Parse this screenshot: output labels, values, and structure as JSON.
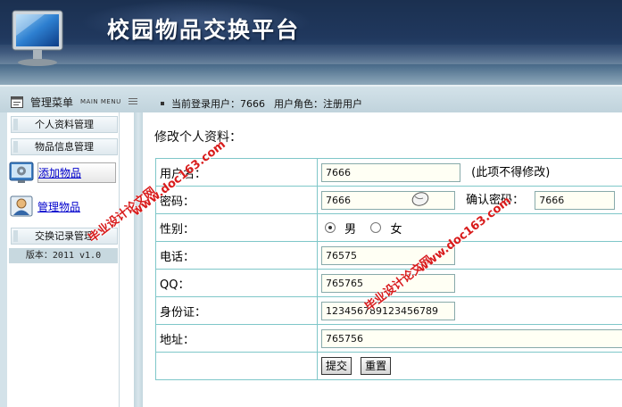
{
  "header": {
    "site_title": "校园物品交换平台"
  },
  "subbar": {
    "menu_title": "管理菜单",
    "menu_subtitle": "MAIN MENU",
    "login_text": "当前登录用户：7666",
    "role_text": "用户角色：注册用户"
  },
  "sidebar": {
    "sections": [
      {
        "label": "个人资料管理"
      },
      {
        "label": "物品信息管理"
      },
      {
        "label": "交换记录管理"
      }
    ],
    "links": [
      {
        "label": "添加物品",
        "icon": "gear-monitor-icon",
        "active": true
      },
      {
        "label": "管理物品",
        "icon": "user-card-icon",
        "active": false
      }
    ],
    "version": "版本：2011 v1.0"
  },
  "form": {
    "title": "修改个人资料：",
    "username_label": "用户名：",
    "username_value": "7666",
    "username_note": "(此项不得修改)",
    "password_label": "密码：",
    "password_value": "7666",
    "confirm_label": "确认密码：",
    "confirm_value": "7666",
    "gender_label": "性别：",
    "gender_male": "男",
    "gender_female": "女",
    "gender_selected": "男",
    "phone_label": "电话：",
    "phone_value": "76575",
    "qq_label": "QQ：",
    "qq_value": "765765",
    "id_label": "身份证：",
    "id_value": "123456789123456789",
    "address_label": "地址：",
    "address_value": "765756",
    "submit_label": "提交",
    "reset_label": "重置"
  },
  "watermark": {
    "cn": "毕业设计论文网",
    "url": "www.doc163.com"
  },
  "colors": {
    "header_dark": "#1b3050",
    "bar": "#c7d8df",
    "table_border": "#7fc7c9",
    "link": "#0000cc",
    "watermark": "#d81b1b"
  }
}
